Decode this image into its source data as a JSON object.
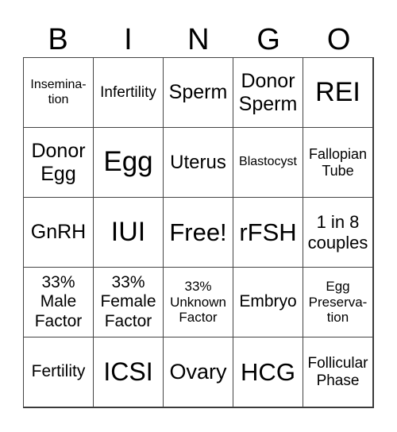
{
  "header": [
    "B",
    "I",
    "N",
    "G",
    "O"
  ],
  "cells": [
    {
      "text": "Insemina-\ntion",
      "size": 16
    },
    {
      "text": "Infertility",
      "size": 19
    },
    {
      "text": "Sperm",
      "size": 25
    },
    {
      "text": "Donor\nSperm",
      "size": 25
    },
    {
      "text": "REI",
      "size": 34
    },
    {
      "text": "Donor\nEgg",
      "size": 25
    },
    {
      "text": "Egg",
      "size": 35
    },
    {
      "text": "Uterus",
      "size": 24
    },
    {
      "text": "Blastocyst",
      "size": 16
    },
    {
      "text": "Fallopian\nTube",
      "size": 18
    },
    {
      "text": "GnRH",
      "size": 25
    },
    {
      "text": "IUI",
      "size": 34
    },
    {
      "text": "Free!",
      "size": 31
    },
    {
      "text": "rFSH",
      "size": 31
    },
    {
      "text": "1 in 8\ncouples",
      "size": 22
    },
    {
      "text": "33%\nMale\nFactor",
      "size": 21
    },
    {
      "text": "33%\nFemale\nFactor",
      "size": 21
    },
    {
      "text": "33%\nUnknown\nFactor",
      "size": 17
    },
    {
      "text": "Embryo",
      "size": 21
    },
    {
      "text": "Egg\nPreserva-\ntion",
      "size": 17
    },
    {
      "text": "Fertility",
      "size": 21
    },
    {
      "text": "ICSI",
      "size": 32
    },
    {
      "text": "Ovary",
      "size": 27
    },
    {
      "text": "HCG",
      "size": 31
    },
    {
      "text": "Follicular\nPhase",
      "size": 19
    }
  ]
}
